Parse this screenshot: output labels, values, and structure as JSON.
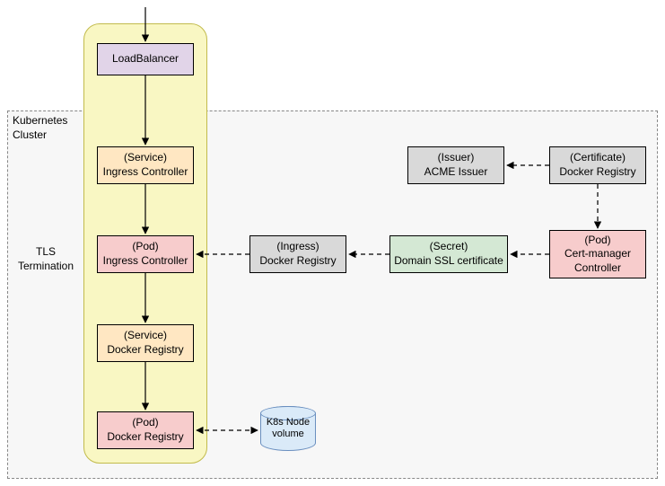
{
  "diagram": {
    "clusterLabel": "Kubernetes\nCluster",
    "tlsLabel": "TLS\nTermination",
    "nodes": {
      "loadBalancer": {
        "line1": "LoadBalancer"
      },
      "svcIngress": {
        "line1": "(Service)",
        "line2": "Ingress Controller"
      },
      "podIngress": {
        "line1": "(Pod)",
        "line2": "Ingress Controller"
      },
      "svcRegistry": {
        "line1": "(Service)",
        "line2": "Docker Registry"
      },
      "podRegistry": {
        "line1": "(Pod)",
        "line2": "Docker Registry"
      },
      "ingressReg": {
        "line1": "(Ingress)",
        "line2": "Docker Registry"
      },
      "secretSsl": {
        "line1": "(Secret)",
        "line2": "Domain SSL certificate"
      },
      "podCertMgr": {
        "line1": "(Pod)",
        "line2": "Cert-manager",
        "line3": "Controller"
      },
      "issuerAcme": {
        "line1": "(Issuer)",
        "line2": "ACME Issuer"
      },
      "certReg": {
        "line1": "(Certificate)",
        "line2": "Docker Registry"
      },
      "volume": {
        "line1": "K8s Node",
        "line2": "volume"
      }
    }
  }
}
